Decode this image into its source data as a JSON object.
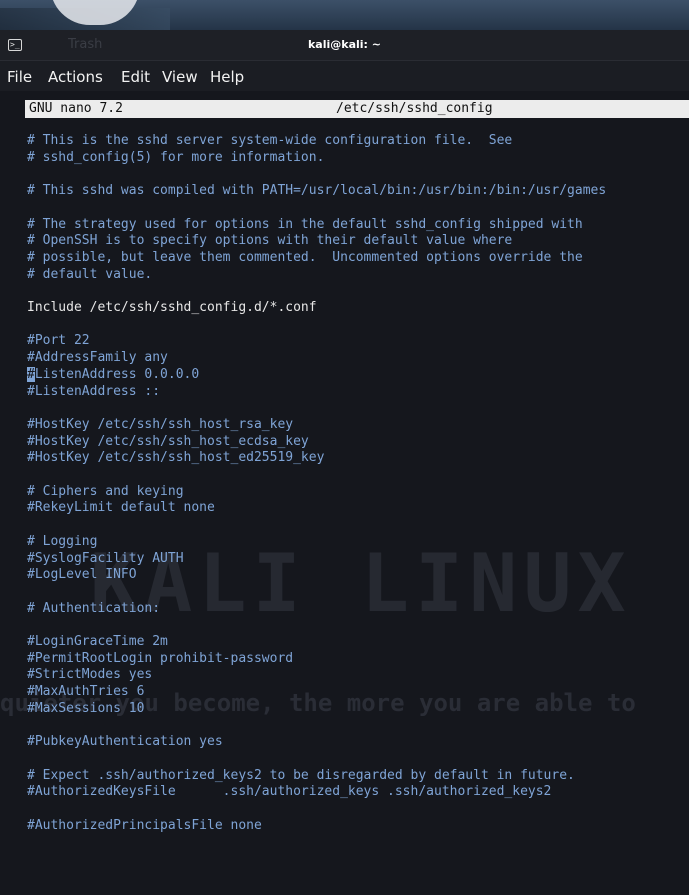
{
  "window": {
    "title": "kali@kali: ~",
    "background_hint": "Trash"
  },
  "menubar": {
    "items": [
      "File",
      "Actions",
      "Edit",
      "View",
      "Help"
    ]
  },
  "nano": {
    "version": "GNU nano 7.2",
    "filename": "/etc/ssh/sshd_config"
  },
  "watermark": {
    "logo": "KALI LINUX",
    "tagline": "quieter you become, the more you are able to"
  },
  "lines": [
    {
      "text": "# This is the sshd server system-wide configuration file.  See",
      "type": "comment"
    },
    {
      "text": "# sshd_config(5) for more information.",
      "type": "comment"
    },
    {
      "text": "",
      "type": "blank"
    },
    {
      "text": "# This sshd was compiled with PATH=/usr/local/bin:/usr/bin:/bin:/usr/games",
      "type": "comment"
    },
    {
      "text": "",
      "type": "blank"
    },
    {
      "text": "# The strategy used for options in the default sshd_config shipped with",
      "type": "comment"
    },
    {
      "text": "# OpenSSH is to specify options with their default value where",
      "type": "comment"
    },
    {
      "text": "# possible, but leave them commented.  Uncommented options override the",
      "type": "comment"
    },
    {
      "text": "# default value.",
      "type": "comment"
    },
    {
      "text": "",
      "type": "blank"
    },
    {
      "text": "Include /etc/ssh/sshd_config.d/*.conf",
      "type": "plain"
    },
    {
      "text": "",
      "type": "blank"
    },
    {
      "text": "#Port 22",
      "type": "comment"
    },
    {
      "text": "#AddressFamily any",
      "type": "comment"
    },
    {
      "text": "#ListenAddress 0.0.0.0",
      "type": "comment",
      "cursor": true
    },
    {
      "text": "#ListenAddress ::",
      "type": "comment"
    },
    {
      "text": "",
      "type": "blank"
    },
    {
      "text": "#HostKey /etc/ssh/ssh_host_rsa_key",
      "type": "comment"
    },
    {
      "text": "#HostKey /etc/ssh/ssh_host_ecdsa_key",
      "type": "comment"
    },
    {
      "text": "#HostKey /etc/ssh/ssh_host_ed25519_key",
      "type": "comment"
    },
    {
      "text": "",
      "type": "blank"
    },
    {
      "text": "# Ciphers and keying",
      "type": "comment"
    },
    {
      "text": "#RekeyLimit default none",
      "type": "comment"
    },
    {
      "text": "",
      "type": "blank"
    },
    {
      "text": "# Logging",
      "type": "comment"
    },
    {
      "text": "#SyslogFacility AUTH",
      "type": "comment"
    },
    {
      "text": "#LogLevel INFO",
      "type": "comment"
    },
    {
      "text": "",
      "type": "blank"
    },
    {
      "text": "# Authentication:",
      "type": "comment"
    },
    {
      "text": "",
      "type": "blank"
    },
    {
      "text": "#LoginGraceTime 2m",
      "type": "comment"
    },
    {
      "text": "#PermitRootLogin prohibit-password",
      "type": "comment"
    },
    {
      "text": "#StrictModes yes",
      "type": "comment"
    },
    {
      "text": "#MaxAuthTries 6",
      "type": "comment"
    },
    {
      "text": "#MaxSessions 10",
      "type": "comment"
    },
    {
      "text": "",
      "type": "blank"
    },
    {
      "text": "#PubkeyAuthentication yes",
      "type": "comment"
    },
    {
      "text": "",
      "type": "blank"
    },
    {
      "text": "# Expect .ssh/authorized_keys2 to be disregarded by default in future.",
      "type": "comment"
    },
    {
      "text": "#AuthorizedKeysFile      .ssh/authorized_keys .ssh/authorized_keys2",
      "type": "comment"
    },
    {
      "text": "",
      "type": "blank"
    },
    {
      "text": "#AuthorizedPrincipalsFile none",
      "type": "comment"
    }
  ],
  "colors": {
    "comment": "#7fa4d6",
    "plain": "#e6e6e6",
    "editor_bg": "#15171d",
    "header_bg": "#ececec"
  }
}
